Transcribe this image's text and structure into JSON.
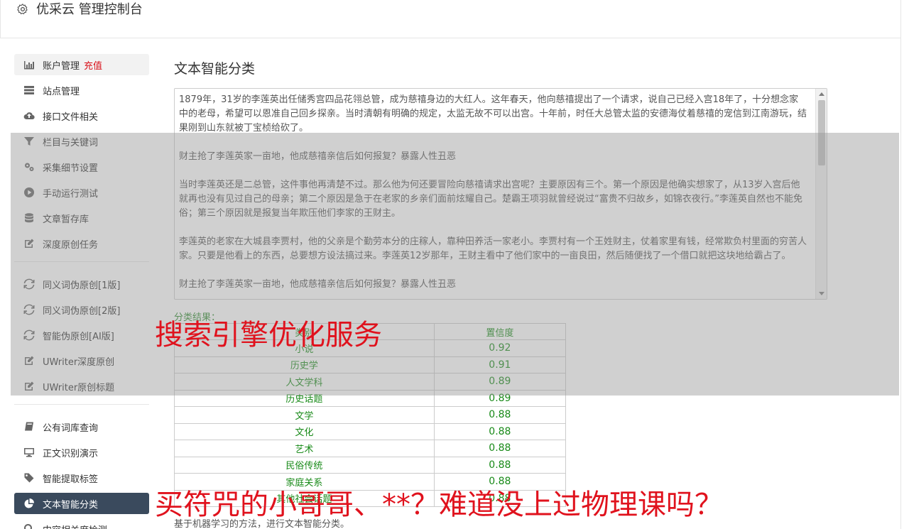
{
  "header": {
    "title": "优采云 管理控制台",
    "icon": "gear-icon"
  },
  "sidebar": {
    "group1": [
      {
        "label": "账户管理",
        "tag": "充值",
        "icon": "bar-chart-icon"
      },
      {
        "label": "站点管理",
        "icon": "server-icon"
      },
      {
        "label": "接口文件相关",
        "icon": "cloud-upload-icon"
      },
      {
        "label": "栏目与关键词",
        "icon": "filter-icon"
      },
      {
        "label": "采集细节设置",
        "icon": "gears-icon"
      },
      {
        "label": "手动运行测试",
        "icon": "play-circle-icon"
      },
      {
        "label": "文章暂存库",
        "icon": "database-icon"
      },
      {
        "label": "深度原创任务",
        "icon": "edit-icon"
      }
    ],
    "group2": [
      {
        "label": "同义词伪原创[1版]",
        "icon": "refresh-icon"
      },
      {
        "label": "同义词伪原创[2版]",
        "icon": "refresh-icon"
      },
      {
        "label": "智能伪原创[AI版]",
        "icon": "refresh-icon"
      },
      {
        "label": "UWriter深度原创",
        "icon": "edit-icon"
      },
      {
        "label": "UWriter原创标题",
        "icon": "edit-icon"
      }
    ],
    "group3": [
      {
        "label": "公有词库查询",
        "icon": "book-icon"
      },
      {
        "label": "正文识别演示",
        "icon": "monitor-icon"
      },
      {
        "label": "智能提取标签",
        "icon": "tag-icon"
      },
      {
        "label": "文本智能分类",
        "icon": "pie-chart-icon",
        "active": true
      },
      {
        "label": "内容相关度检测",
        "icon": "search-icon"
      }
    ]
  },
  "main": {
    "title": "文本智能分类",
    "input_text": "1879年，31岁的李莲英出任储秀宫四品花翎总管，成为慈禧身边的大红人。这年春天，他向慈禧提出了一个请求，说自己已经入宫18年了，十分想念家中的老母，希望可以恩准自己回乡探亲。当时清朝有明确的规定，太监无故不可以出宫。十年前，时任大总管太监的安德海仗着慈禧的宠信到江南游玩，结果刚到山东就被丁宝桢给砍了。\n\n财主抢了李莲英家一亩地，他成慈禧亲信后如何报复？暴露人性丑恶\n\n当时李莲英还是二总管，这件事他再清楚不过。那么他为何还要冒险向慈禧请求出宫呢？主要原因有三个。第一个原因是他确实想家了，从13岁入宫后他就再也没有见过自己的母亲；第二个原因是急于在老家的乡亲们面前炫耀自己。楚霸王项羽就曾经说过“富贵不归故乡，如锦衣夜行。”李莲英自然也不能免俗；第三个原因就是报复当年欺压他们李家的王财主。\n\n李莲英的老家在大城县李贾村，他的父亲是个勤劳本分的庄稼人，靠种田养活一家老小。李贾村有一个王姓财主，仗着家里有钱，经常欺负村里面的穷苦人家。只要是他看上的东西，总要想方设法搞过来。李莲英12岁那年，王财主看中了他们家中的一亩良田，然后随便找了一个借口就把这块地给霸占了。\n\n财主抢了李莲英家一亩地，他成慈禧亲信后如何报复？暴露人性丑恶",
    "result_label": "分类结果：",
    "table_headers": [
      "类别",
      "置信度"
    ],
    "results": [
      {
        "category": "小说",
        "score": "0.92"
      },
      {
        "category": "历史学",
        "score": "0.91"
      },
      {
        "category": "人文学科",
        "score": "0.89"
      },
      {
        "category": "历史话题",
        "score": "0.89"
      },
      {
        "category": "文学",
        "score": "0.88"
      },
      {
        "category": "文化",
        "score": "0.88"
      },
      {
        "category": "艺术",
        "score": "0.88"
      },
      {
        "category": "民俗传统",
        "score": "0.88"
      },
      {
        "category": "家庭关系",
        "score": "0.88"
      },
      {
        "category": "其他社会话题",
        "score": "0.88"
      }
    ],
    "footer_note": "基于机器学习的方法，进行文本智能分类。"
  },
  "watermarks": {
    "top": "搜索引擎优化服务",
    "bottom": "买符咒的小哥哥、**？难道没上过物理课吗？"
  },
  "colors": {
    "accent_active": "#3a4a5d",
    "result_green": "#188a18",
    "watermark_red": "#e0121d",
    "tag_red": "#d9121b"
  }
}
